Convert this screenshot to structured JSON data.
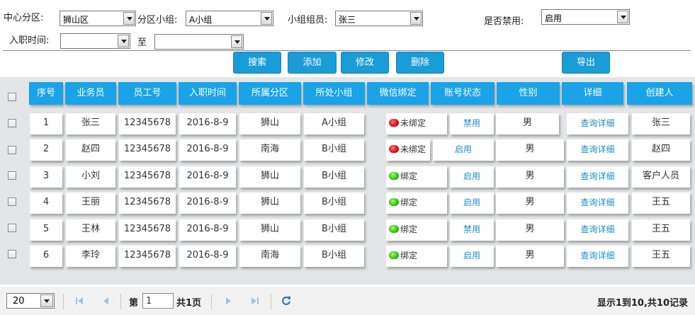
{
  "filters": {
    "center_label": "中心分区:",
    "center_value": "狮山区",
    "subgroup_label": "分区小组:",
    "subgroup_value": "A小组",
    "member_label": "小组组员:",
    "member_value": "张三",
    "disabled_label": "是否禁用:",
    "disabled_value": "启用",
    "hire_label": "入职时间:",
    "hire_from": "",
    "hire_to_label": "至",
    "hire_to": ""
  },
  "toolbar": {
    "search": "搜索",
    "add": "添加",
    "edit": "修改",
    "delete": "删除",
    "export": "导出"
  },
  "table": {
    "headers": [
      "序号",
      "业务员",
      "员工号",
      "入职时间",
      "所属分区",
      "所处小组",
      "微信绑定",
      "账号状态",
      "性别",
      "详细",
      "创建人"
    ],
    "rows": [
      {
        "no": "1",
        "name": "张三",
        "emp_id": "12345678",
        "hire_date": "2016-8-9",
        "zone": "狮山",
        "group": "A小组",
        "wechat": "未绑定",
        "wechat_bound": false,
        "status": "禁用",
        "gender": "男",
        "detail": "查询详细",
        "creator": "张三"
      },
      {
        "no": "2",
        "name": "赵四",
        "emp_id": "12345678",
        "hire_date": "2016-8-9",
        "zone": "南海",
        "group": "B小组",
        "wechat": "未绑定",
        "wechat_bound": false,
        "status": "启用",
        "gender": "男",
        "detail": "查询详细",
        "creator": "赵四"
      },
      {
        "no": "3",
        "name": "小刘",
        "emp_id": "12345678",
        "hire_date": "2016-8-9",
        "zone": "狮山",
        "group": "B小组",
        "wechat": "绑定",
        "wechat_bound": true,
        "status": "启用",
        "gender": "男",
        "detail": "查询详细",
        "creator": "客户人员"
      },
      {
        "no": "4",
        "name": "王丽",
        "emp_id": "12345678",
        "hire_date": "2016-8-9",
        "zone": "狮山",
        "group": "B小组",
        "wechat": "绑定",
        "wechat_bound": true,
        "status": "启用",
        "gender": "男",
        "detail": "查询详细",
        "creator": "王五"
      },
      {
        "no": "5",
        "name": "王林",
        "emp_id": "12345678",
        "hire_date": "2016-8-9",
        "zone": "狮山",
        "group": "B小组",
        "wechat": "绑定",
        "wechat_bound": true,
        "status": "禁用",
        "gender": "男",
        "detail": "查询详细",
        "creator": "王五"
      },
      {
        "no": "6",
        "name": "李玲",
        "emp_id": "12345678",
        "hire_date": "2016-8-9",
        "zone": "南海",
        "group": "B小组",
        "wechat": "绑定",
        "wechat_bound": true,
        "status": "启用",
        "gender": "男",
        "detail": "查询详细",
        "creator": "王五"
      }
    ]
  },
  "pager": {
    "page_size": "20",
    "page_prefix": "第",
    "page_value": "1",
    "page_total": "共1页",
    "info": "显示1到10,共10记录",
    "icons": {
      "first": "first-page-icon",
      "prev": "prev-page-icon",
      "next": "next-page-icon",
      "last": "last-page-icon",
      "refresh": "refresh-icon"
    }
  },
  "colors": {
    "header_bg": "#1aa3e6",
    "button_bg": "#1a9cd7",
    "link": "#1a8cc9",
    "grid_bg": "#e4e5e7",
    "unbound_dot": "#d30000",
    "bound_dot": "#1db400"
  }
}
